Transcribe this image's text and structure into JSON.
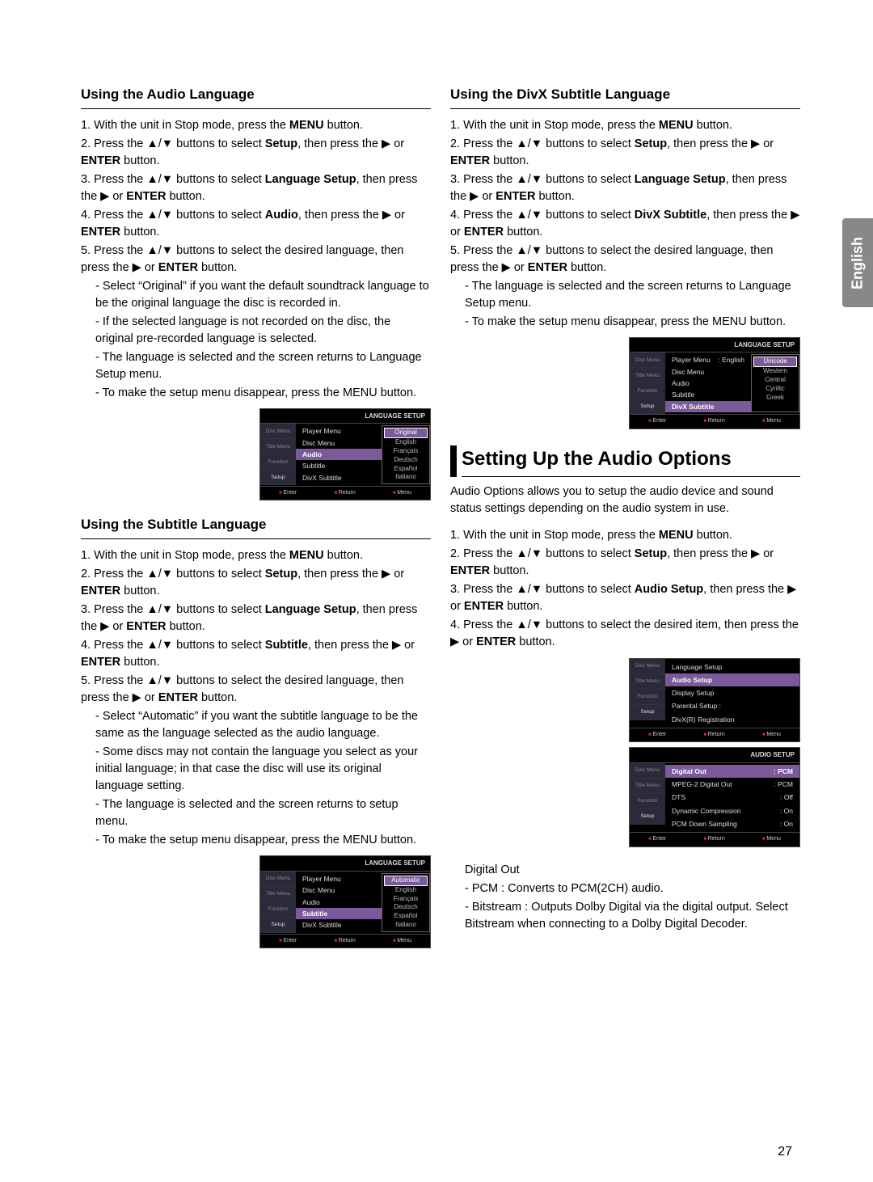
{
  "lang_tab": "English",
  "page_number": "27",
  "left": {
    "sec1": {
      "heading": "Using the Audio Language",
      "steps": [
        "1. With the unit in Stop mode, press the <b>MENU</b> button.",
        "2. Press the ▲/▼ buttons to select <b>Setup</b>, then press the ▶ or <b>ENTER</b> button.",
        "3. Press the ▲/▼ buttons to select <b>Language Setup</b>, then press the ▶ or <b>ENTER</b> button.",
        "4. Press the ▲/▼ buttons to select <b>Audio</b>, then press the ▶ or <b>ENTER</b> button.",
        "5. Press the ▲/▼ buttons to select the desired language, then press the ▶ or <b>ENTER</b> button."
      ],
      "subs": [
        "- Select “Original” if you want the default soundtrack language to be the original language the disc is recorded in.",
        "- If the selected language is not recorded on the disc, the original pre-recorded language is selected.",
        "- The language is selected and the screen returns to Language Setup menu.",
        "- To make the setup menu disappear, press the MENU button."
      ]
    },
    "sec2": {
      "heading": "Using the Subtitle Language",
      "steps": [
        "1. With the unit in Stop mode, press the <b>MENU</b> button.",
        "2. Press the ▲/▼ buttons to select <b>Setup</b>, then press the ▶ or <b>ENTER</b> button.",
        "3. Press the ▲/▼ buttons to select <b>Language Setup</b>, then press the ▶ or <b>ENTER</b> button.",
        "4. Press the ▲/▼ buttons to select <b>Subtitle</b>, then press the ▶ or <b>ENTER</b> button.",
        "5. Press the ▲/▼ buttons to select the desired  language, then press the ▶ or <b>ENTER</b> button."
      ],
      "subs": [
        "- Select “Automatic” if you want the subtitle  language to be the same as the language selected as the audio language.",
        "- Some discs may not contain the language you select as your initial language; in that case the disc will use its original language setting.",
        "- The language is selected and the screen returns to setup menu.",
        "- To make the setup menu disappear, press the MENU button."
      ]
    }
  },
  "right": {
    "sec1": {
      "heading": "Using the DivX Subtitle Language",
      "steps": [
        "1. With the unit in Stop mode, press the <b>MENU</b> button.",
        "2. Press the ▲/▼ buttons to select <b>Setup</b>, then press the ▶ or <b>ENTER</b> button.",
        "3. Press the ▲/▼ buttons to select <b>Language Setup</b>, then press the ▶ or <b>ENTER</b> button.",
        "4. Press the ▲/▼ buttons to select <b>DivX Subtitle</b>, then press the ▶ or <b>ENTER</b> button.",
        "5. Press the ▲/▼ buttons to select the desired  language, then press the ▶ or <b>ENTER</b> button."
      ],
      "subs": [
        "- The language is selected and the screen returns to Language Setup menu.",
        "- To make the setup menu disappear, press the MENU button."
      ]
    },
    "sec2": {
      "heading": "Setting Up the Audio Options",
      "intro": "Audio Options allows you to setup the audio device and sound status settings depending on the audio system in use.",
      "steps": [
        "1. With the unit in Stop mode, press the <b>MENU</b> button.",
        "2. Press the ▲/▼ buttons to select <b>Setup</b>, then press the ▶ or <b>ENTER</b> button.",
        "3. Press the ▲/▼ buttons to select <b>Audio Setup</b>, then press the ▶ or <b>ENTER</b> button.",
        "4. Press the ▲/▼ buttons to select the desired item, then press the ▶ or <b>ENTER</b> button."
      ],
      "digital_label": "Digital Out",
      "digital": [
        "- PCM : Converts to PCM(2CH) audio.",
        "- Bitstream : Outputs Dolby Digital via the digital output. Select Bitstream when connecting to a Dolby Digital Decoder."
      ]
    }
  },
  "osd": {
    "langsetup_title": "LANGUAGE SETUP",
    "audiosetup_title": "AUDIO SETUP",
    "tabs": [
      "Disc Menu",
      "Title Menu",
      "Function",
      "Setup"
    ],
    "footer": [
      "Enter",
      "Return",
      "Menu"
    ],
    "menu1": {
      "items": [
        "Player Menu",
        "Disc Menu",
        "Audio",
        "Subtitle",
        "DivX Subtitle"
      ],
      "hl": "Audio",
      "opts": [
        "Original",
        "English",
        "Français",
        "Deutsch",
        "Español",
        "Italiano"
      ],
      "opt_hl": "Original"
    },
    "menu2": {
      "items": [
        "Player Menu",
        "Disc Menu",
        "Audio",
        "Subtitle",
        "DivX Subtitle"
      ],
      "hl": "Subtitle",
      "opts": [
        "Automatic",
        "English",
        "Français",
        "Deutsch",
        "Español",
        "Italiano"
      ],
      "opt_hl": "Automatic"
    },
    "menu3": {
      "items": [
        {
          "l": "Player Menu",
          "r": ": English"
        },
        {
          "l": "Disc Menu",
          "r": ""
        },
        {
          "l": "Audio",
          "r": ""
        },
        {
          "l": "Subtitle",
          "r": ""
        },
        {
          "l": "DivX Subtitle",
          "r": ""
        }
      ],
      "hl": "DivX Subtitle",
      "opts": [
        "Unicode",
        "Western",
        "Central",
        "Cyrillic",
        "Greek"
      ],
      "opt_hl": "Unicode"
    },
    "menu4": {
      "items": [
        "Language Setup",
        "Audio Setup",
        "Display Setup",
        "Parental Setup :",
        "DivX(R) Registration"
      ],
      "hl": "Audio Setup"
    },
    "menu5": {
      "items": [
        {
          "l": "Digital Out",
          "r": ": PCM"
        },
        {
          "l": "MPEG-2 Digital Out",
          "r": ": PCM"
        },
        {
          "l": "DTS",
          "r": ": Off"
        },
        {
          "l": "Dynamic Compression",
          "r": ": On"
        },
        {
          "l": "PCM Down Sampling",
          "r": ": On"
        }
      ],
      "hl": "Digital Out"
    }
  }
}
